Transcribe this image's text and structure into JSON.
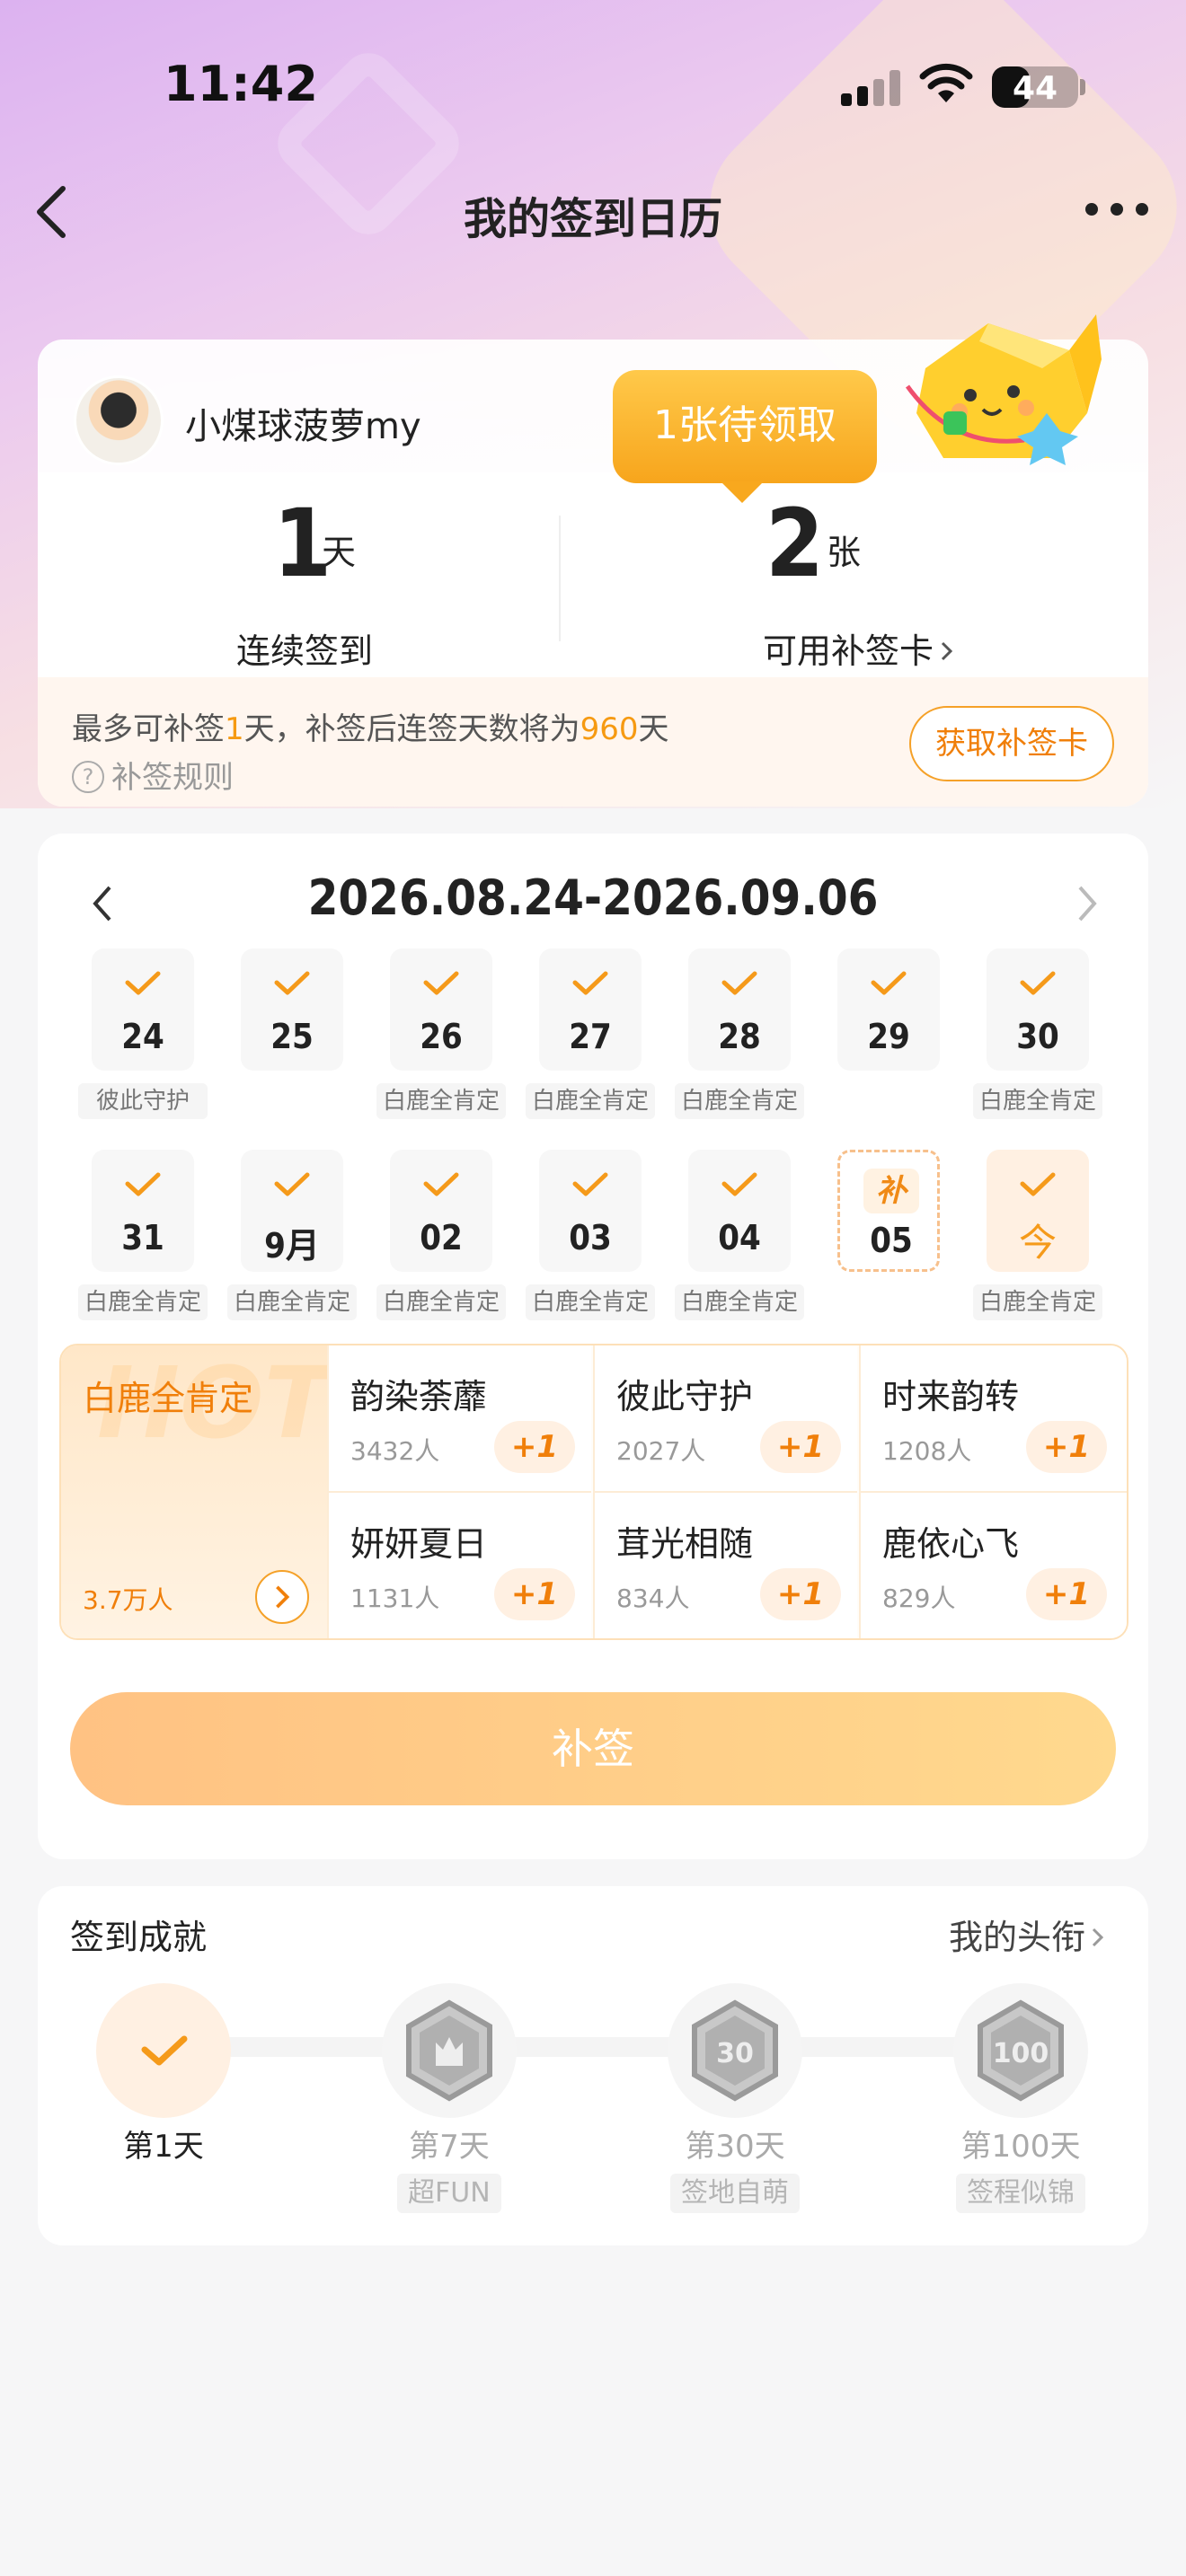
{
  "status_bar": {
    "time": "11:42",
    "battery": "44",
    "battery_level": 0.44
  },
  "nav": {
    "title": "我的签到日历"
  },
  "profile": {
    "username": "小煤球菠萝my"
  },
  "tooltip": "1张待领取",
  "stats": {
    "streak": {
      "value": "1",
      "unit": "天",
      "label": "连续签到"
    },
    "cards": {
      "value": "2",
      "unit": "张",
      "label": "可用补签卡"
    }
  },
  "rule": {
    "text_a": "最多可补签",
    "days": "1",
    "text_b": "天，补签后连签天数将为",
    "total": "960",
    "text_c": "天",
    "help": "补签规则",
    "help_icon": "?",
    "button": "获取补签卡"
  },
  "calendar": {
    "range": "2026.08.24-2026.09.06",
    "makeup_badge": "补",
    "days": [
      {
        "label": "24",
        "tag": "彼此守护",
        "checked": true
      },
      {
        "label": "25",
        "tag": "",
        "checked": true
      },
      {
        "label": "26",
        "tag": "白鹿全肯定",
        "checked": true
      },
      {
        "label": "27",
        "tag": "白鹿全肯定",
        "checked": true
      },
      {
        "label": "28",
        "tag": "白鹿全肯定",
        "checked": true
      },
      {
        "label": "29",
        "tag": "",
        "checked": true
      },
      {
        "label": "30",
        "tag": "白鹿全肯定",
        "checked": true
      },
      {
        "label": "31",
        "tag": "白鹿全肯定",
        "checked": true
      },
      {
        "label": "9月",
        "tag": "白鹿全肯定",
        "checked": true
      },
      {
        "label": "02",
        "tag": "白鹿全肯定",
        "checked": true
      },
      {
        "label": "03",
        "tag": "白鹿全肯定",
        "checked": true
      },
      {
        "label": "04",
        "tag": "白鹿全肯定",
        "checked": true
      },
      {
        "label": "05",
        "tag": "",
        "checked": false,
        "makeup": true
      },
      {
        "label": "今",
        "tag": "白鹿全肯定",
        "checked": true,
        "today": true
      }
    ]
  },
  "tags": {
    "featured": {
      "hot": "HOT",
      "name": "白鹿全肯定",
      "count": "3.7万人"
    },
    "plus_label": "+1",
    "items": [
      {
        "name": "韵染荼蘼",
        "count": "3432人"
      },
      {
        "name": "彼此守护",
        "count": "2027人"
      },
      {
        "name": "时来韵转",
        "count": "1208人"
      },
      {
        "name": "妍妍夏日",
        "count": "1131人"
      },
      {
        "name": "茸光相随",
        "count": "834人"
      },
      {
        "name": "鹿依心飞",
        "count": "829人"
      }
    ]
  },
  "makeup_button": "补签",
  "achievements": {
    "title": "签到成就",
    "link": "我的头衔",
    "items": [
      {
        "day": "第1天",
        "badge": "",
        "done": true
      },
      {
        "day": "第7天",
        "badge": "超FUN",
        "done": false
      },
      {
        "day": "第30天",
        "badge": "签地自萌",
        "done": false
      },
      {
        "day": "第100天",
        "badge": "签程似锦",
        "done": false
      }
    ],
    "medal_text": [
      "",
      "",
      "30",
      "100"
    ]
  },
  "colors": {
    "accent": "#f69a12",
    "accent_light": "#fff0e2",
    "button_gradient_start": "#ffc283",
    "button_gradient_end": "#ffd98e"
  }
}
